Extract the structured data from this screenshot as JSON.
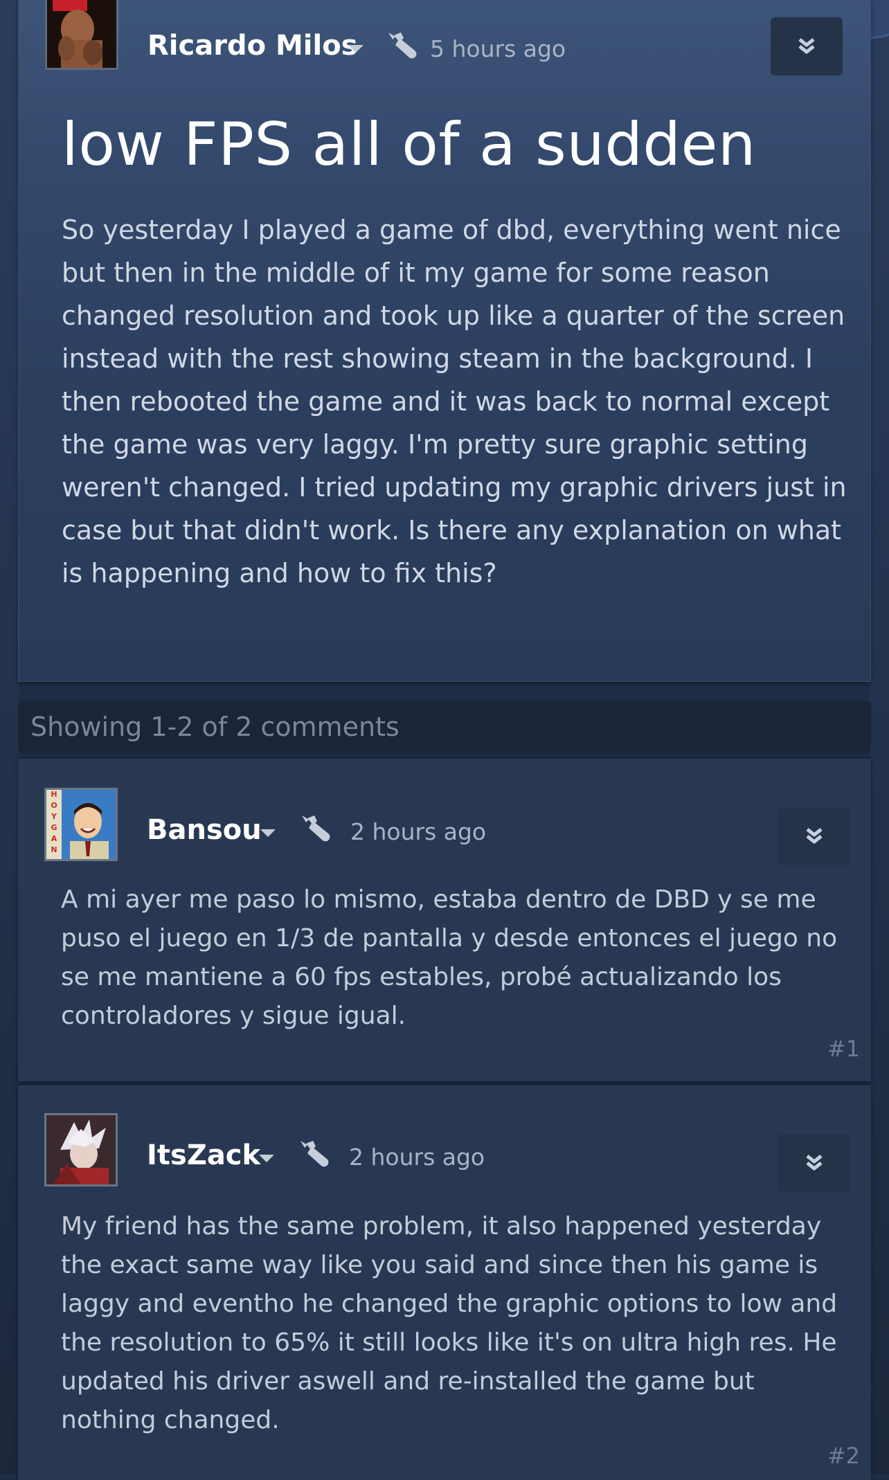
{
  "post": {
    "author": "Ricardo Milos",
    "time": "5 hours ago",
    "title": "low FPS all of a sudden",
    "body": "So yesterday I played a game of dbd, everything went nice but then in the middle of it my game for some reason changed resolution and took up like a quarter of the screen instead with the rest showing steam in the background. I then rebooted the game and it was back to normal except the game was very laggy. I'm pretty sure graphic setting weren't changed. I tried updating my graphic drivers just in case but that didn't work. Is there any explanation on what is happening and how to fix this?"
  },
  "comments_bar": {
    "text": "Showing 1-2 of 2 comments"
  },
  "comments": [
    {
      "author": "Bansou",
      "time": "2 hours ago",
      "body": "A mi ayer me paso lo mismo, estaba dentro de DBD y se me puso el juego en 1/3 de pantalla y desde entonces el juego no se me mantiene a 60 fps estables, probé actualizando los controladores y sigue igual.",
      "number": "#1",
      "avatar_text": "HOYGAN"
    },
    {
      "author": "ItsZack",
      "time": "2 hours ago",
      "body": "My friend has the same problem, it also happened yesterday the exact same way like you said and since then his game is laggy and eventho he changed the graphic options to low and the resolution to 65% it still looks like it's on ultra high res. He updated his driver aswell and re-installed the game but nothing changed.",
      "number": "#2"
    }
  ],
  "colors": {
    "background": "#1f2d44",
    "card_top": "#3d5579",
    "comment_card": "#293852",
    "text_primary": "#ffffff",
    "text_body": "#d0d8e4",
    "text_muted": "#a9b4c6"
  },
  "icons": {
    "post_icon": "quill-pen-icon",
    "more_button": "double-chevron-down-icon",
    "dropdown": "caret-down-icon"
  }
}
